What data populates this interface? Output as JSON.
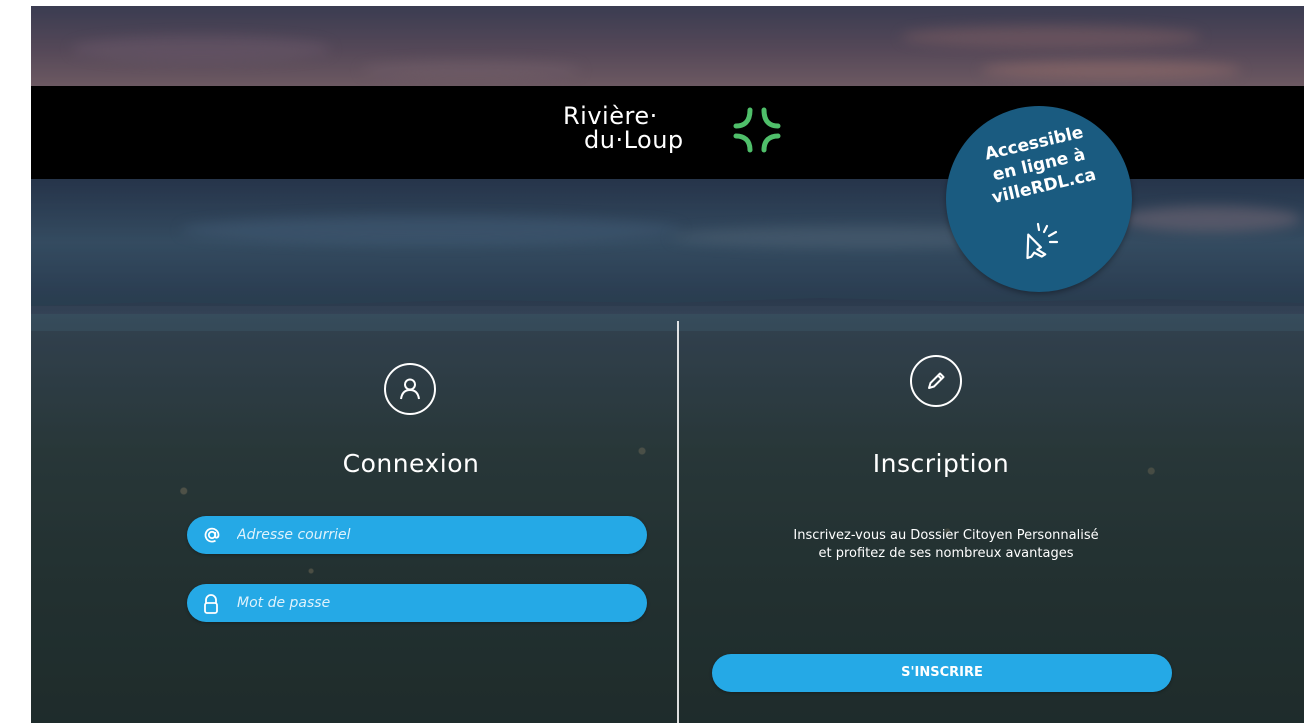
{
  "brand": {
    "line1": "Rivière·",
    "line2": "du·Loup"
  },
  "badge": {
    "line1": "Accessible",
    "line2": "en ligne à",
    "line3": "villeRDL.ca",
    "icon": "cursor-click-icon"
  },
  "login": {
    "title": "Connexion",
    "icon": "user-icon",
    "email": {
      "placeholder": "Adresse courriel",
      "value": "",
      "icon": "at-icon"
    },
    "password": {
      "placeholder": "Mot de passe",
      "value": "",
      "icon": "lock-icon"
    }
  },
  "signup": {
    "title": "Inscription",
    "icon": "pencil-icon",
    "description": "Inscrivez-vous au Dossier Citoyen Personnalisé et profitez de ses nombreux avantages",
    "button_label": "S'INSCRIRE"
  },
  "colors": {
    "accent": "#25a9e6",
    "badge": "#1a5b80",
    "logo_green": "#4fbf6a",
    "bar": "#000000"
  }
}
